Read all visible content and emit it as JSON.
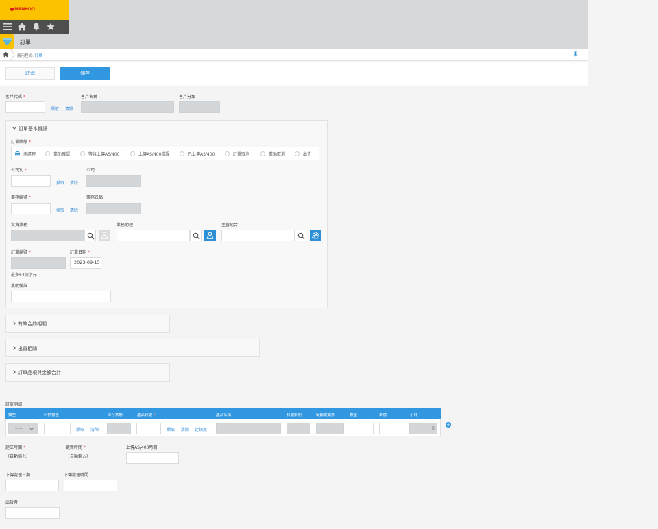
{
  "header": {
    "logo_text": "MANHOO",
    "page_title": "訂單"
  },
  "breadcrumb": {
    "prefix": "應用程式: ",
    "current": "訂單"
  },
  "actions": {
    "cancel_label": "取消",
    "save_label": "儲存"
  },
  "customer": {
    "code_label": "客戶代碼",
    "name_label": "客戶名稱",
    "category_label": "客戶分類",
    "fetch_label": "擷取",
    "clear_label": "清除"
  },
  "basic_section": {
    "title": "訂單基本資訊",
    "status_label": "訂單狀態",
    "status_options": [
      "未處理",
      "業助確認",
      "等待上傳AS/400",
      "上傳AS/400錯誤",
      "已上傳AS/400",
      "訂單取消",
      "業助取消",
      "出貨"
    ],
    "status_selected": "未處理",
    "company_code_label": "公司別",
    "company_label": "公司",
    "sales_code_label": "業務編號",
    "sales_name_label": "業務名稱",
    "responsible_label": "負責業務",
    "assistant_label": "業務助理",
    "supervisor_label": "主管組合",
    "order_no_label": "訂單編號",
    "order_no_hint": "最多64個字元",
    "order_date_label": "訂單日期",
    "order_date_value": "2023-09-15",
    "assistant_note_label": "業助備註",
    "fetch_label": "擷取",
    "clear_label": "清除"
  },
  "sections": {
    "contract": "有效合約相關",
    "shipping": "出貨相關",
    "items_total": "訂單品項與金額合計"
  },
  "details": {
    "title": "訂單明細",
    "columns": [
      "類型",
      "料件檢查",
      "庫存狀態",
      "產品料號",
      "產品名稱",
      "料號規則",
      "促銷案編號",
      "數量",
      "單價",
      "小計"
    ],
    "row": {
      "type_value": "-----",
      "fetch_label": "擷取",
      "clear_label": "清除",
      "promo_label": "促銷案",
      "subtotal": "0"
    }
  },
  "footer_fields": {
    "created_label": "建立時間",
    "created_value": "（自動輸入）",
    "updated_label": "更新時間",
    "updated_value": "（自動輸入）",
    "upload_label": "上傳AS/400時間",
    "next_date_label": "下傳處理日期",
    "next_time_label": "下傳處理時間",
    "shipper_label": "出貨者"
  },
  "icons": {
    "menu": "menu-icon",
    "home": "home-icon",
    "bell": "bell-icon",
    "star": "star-icon",
    "search": "search-icon",
    "user": "user-icon",
    "group": "group-icon",
    "pin": "pin-icon",
    "add": "add-circle-icon"
  },
  "colors": {
    "brand_yellow": "#fcc200",
    "accent_blue": "#3197e0",
    "required_red": "#e23a3a"
  }
}
